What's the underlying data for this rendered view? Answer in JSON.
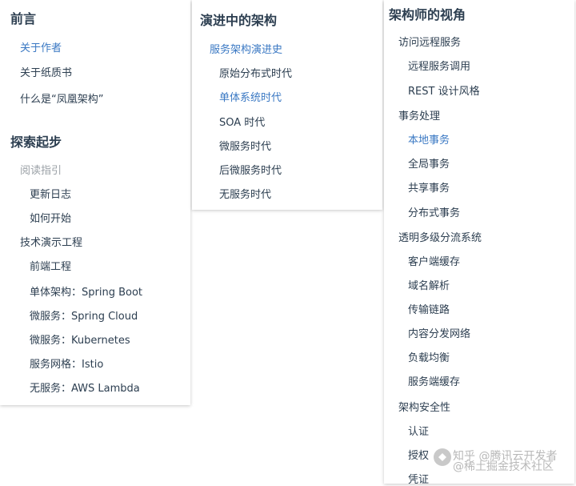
{
  "col1": {
    "preface_title": "前言",
    "preface": [
      "关于作者",
      "关于纸质书",
      "什么是“凤凰架构”"
    ],
    "explore_title": "探索起步",
    "reading_guide": "阅读指引",
    "guide_items": [
      "更新日志",
      "如何开始"
    ],
    "demo_title": "技术演示工程",
    "demo_items": [
      "前端工程",
      "单体架构：Spring Boot",
      "微服务：Spring Cloud",
      "微服务：Kubernetes",
      "服务网格：Istio",
      "无服务：AWS Lambda"
    ]
  },
  "col2": {
    "title": "演进中的架构",
    "group": "服务架构演进史",
    "items": [
      "原始分布式时代",
      "单体系统时代",
      "SOA 时代",
      "微服务时代",
      "后微服务时代",
      "无服务时代"
    ]
  },
  "col3": {
    "title": "架构师的视角",
    "remote_title": "访问远程服务",
    "remote_items": [
      "远程服务调用",
      "REST 设计风格"
    ],
    "tx_title": "事务处理",
    "tx_items": [
      "本地事务",
      "全局事务",
      "共享事务",
      "分布式事务"
    ],
    "cdn_title": "透明多级分流系统",
    "cdn_items": [
      "客户端缓存",
      "域名解析",
      "传输链路",
      "内容分发网络",
      "负载均衡",
      "服务端缓存"
    ],
    "sec_title": "架构安全性",
    "sec_items": [
      "认证",
      "授权",
      "凭证"
    ]
  },
  "watermark": {
    "line1": "知乎 @腾讯云开发者",
    "line2": "@稀土掘金技术社区"
  },
  "colors": {
    "accent": "#3a78c3",
    "text": "#2c3e50",
    "muted": "#9aa0a6"
  }
}
